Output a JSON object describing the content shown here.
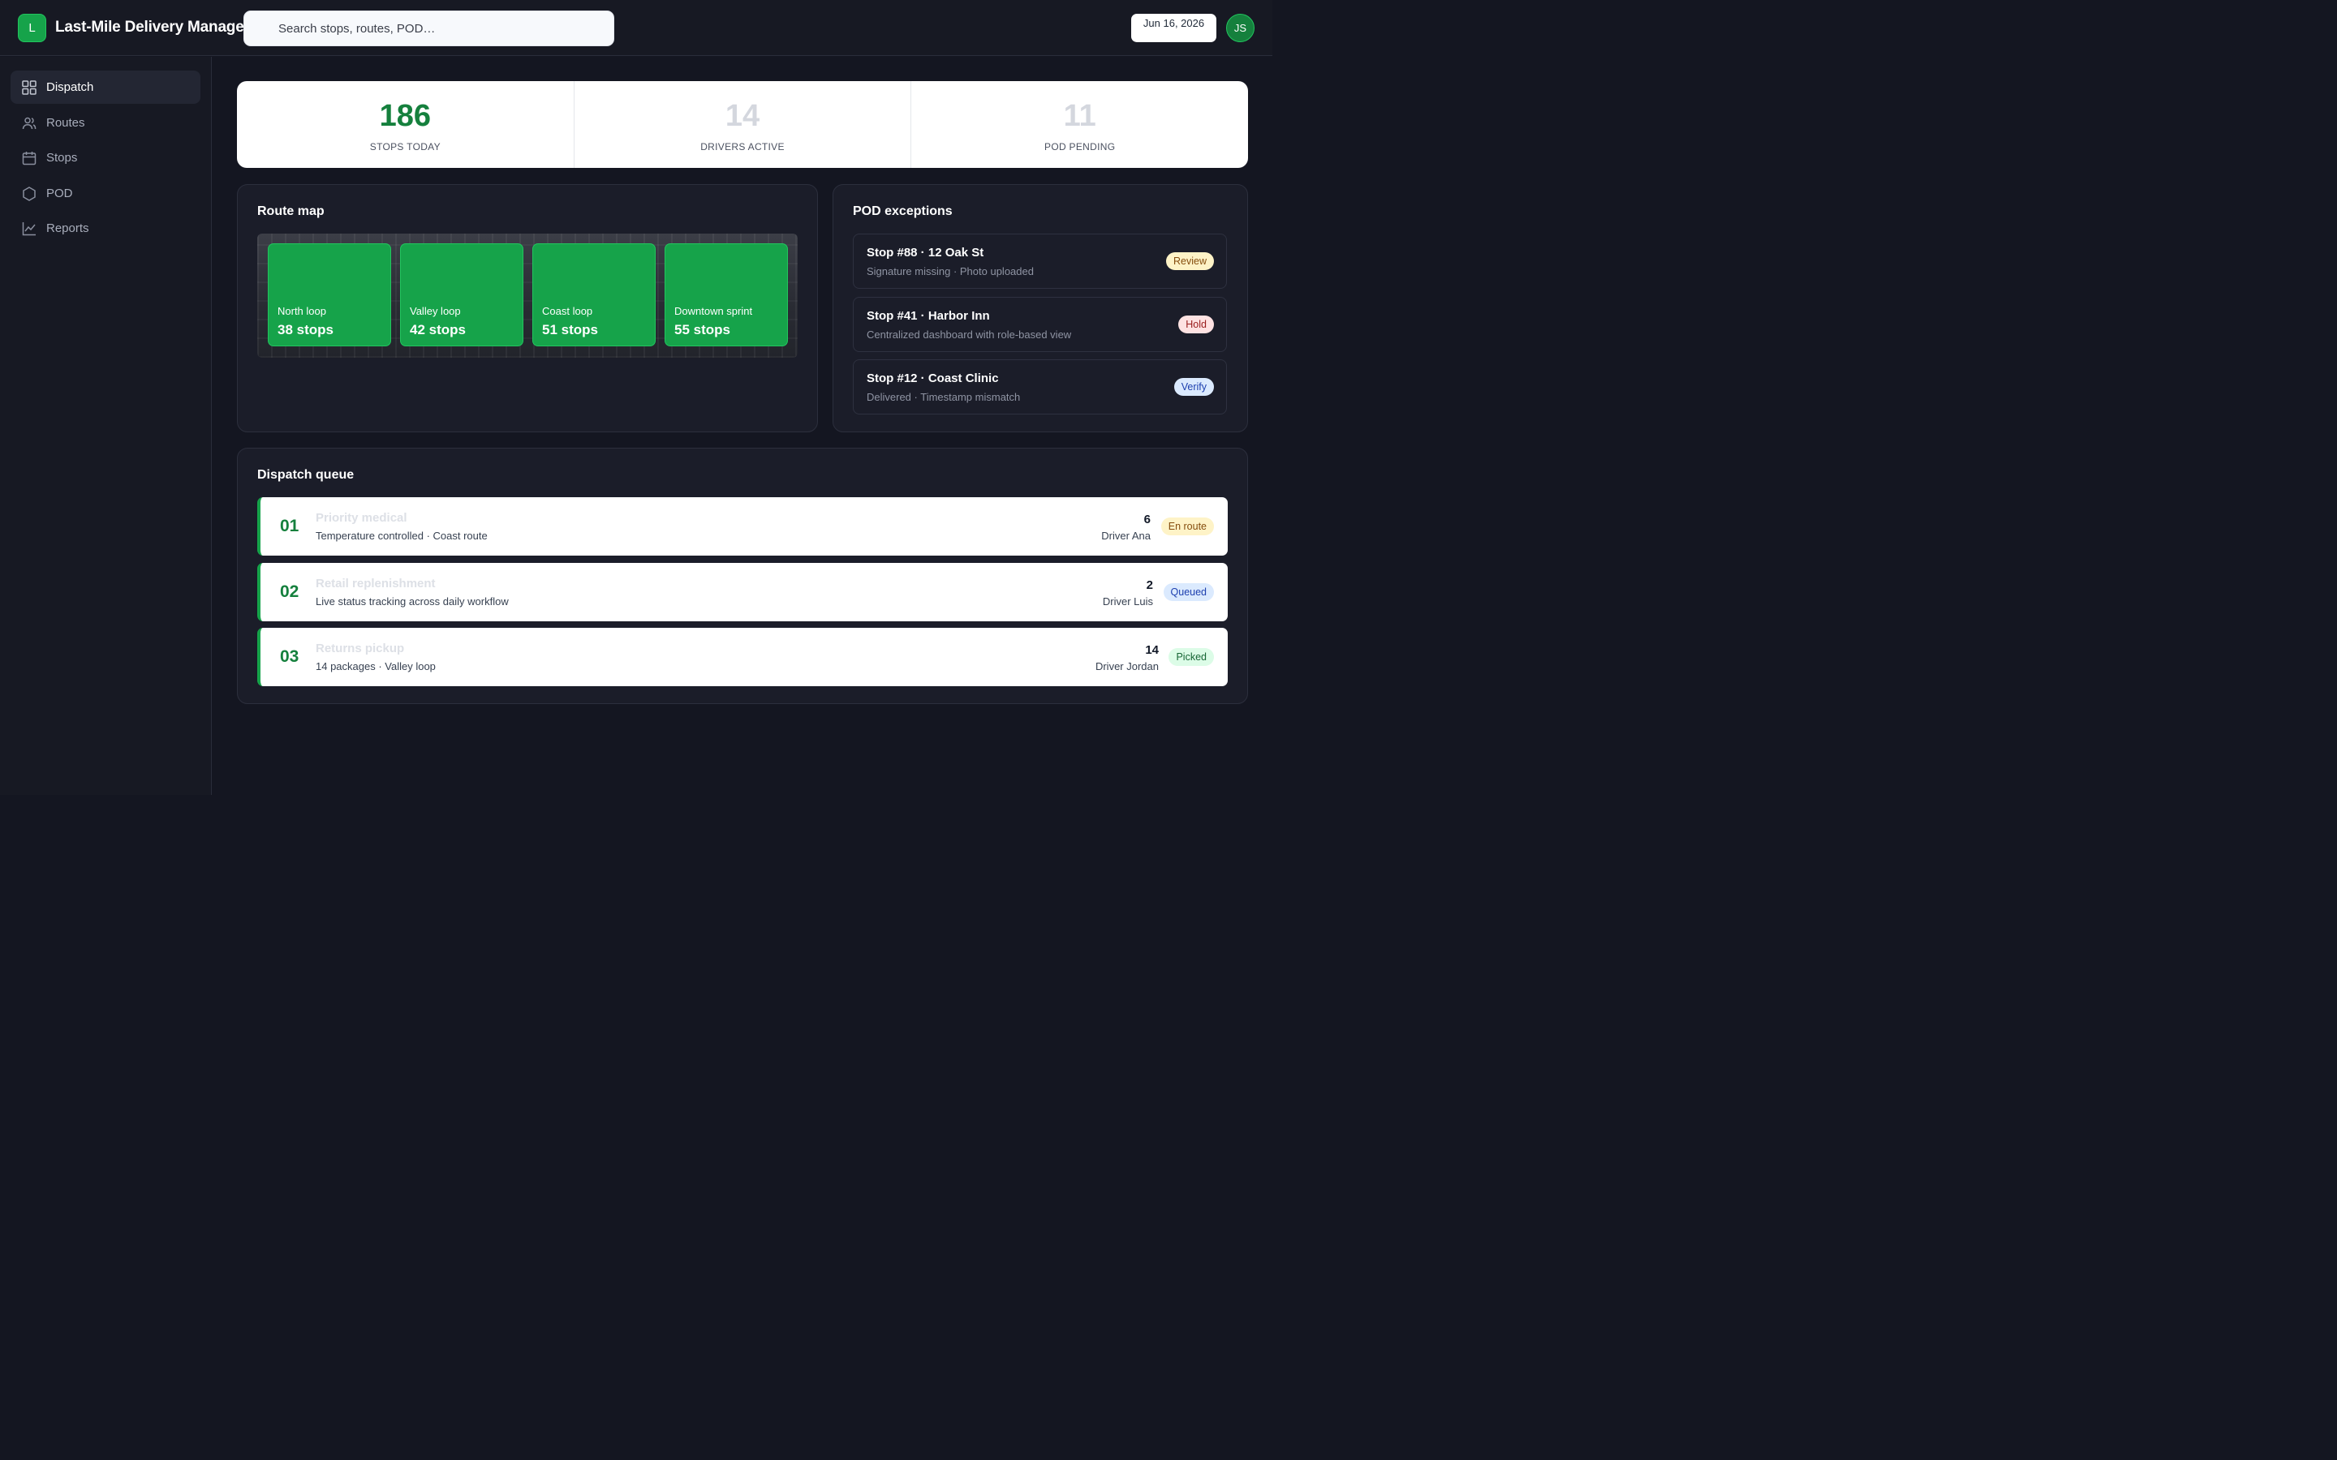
{
  "header": {
    "logo_letter": "L",
    "app_title": "Last-Mile Delivery Manager",
    "search_placeholder": "Search stops, routes, POD…",
    "date": "Jun 16, 2026",
    "user_initials": "JS"
  },
  "sidebar": {
    "items": [
      {
        "label": "Dispatch",
        "icon": "grid-icon",
        "active": true
      },
      {
        "label": "Routes",
        "icon": "users-icon",
        "active": false
      },
      {
        "label": "Stops",
        "icon": "calendar-icon",
        "active": false
      },
      {
        "label": "POD",
        "icon": "hexagon-icon",
        "active": false
      },
      {
        "label": "Reports",
        "icon": "chart-line-icon",
        "active": false
      }
    ]
  },
  "stats": [
    {
      "value": "186",
      "label": "STOPS TODAY"
    },
    {
      "value": "14",
      "label": "DRIVERS ACTIVE"
    },
    {
      "value": "11",
      "label": "POD PENDING"
    }
  ],
  "route_map": {
    "title": "Route map",
    "routes": [
      {
        "name": "North loop",
        "stops": "38 stops"
      },
      {
        "name": "Valley loop",
        "stops": "42 stops"
      },
      {
        "name": "Coast loop",
        "stops": "51 stops"
      },
      {
        "name": "Downtown sprint",
        "stops": "55 stops"
      }
    ]
  },
  "pod_exceptions": {
    "title": "POD exceptions",
    "items": [
      {
        "title": "Stop #88 · 12 Oak St",
        "sub": "Signature missing · Photo uploaded",
        "badge": "Review",
        "badge_color": "#fef3c7"
      },
      {
        "title": "Stop #41 · Harbor Inn",
        "sub": "Centralized dashboard with role-based view",
        "badge": "Hold",
        "badge_color": "#fee2e2"
      },
      {
        "title": "Stop #12 · Coast Clinic",
        "sub": "Delivered · Timestamp mismatch",
        "badge": "Verify",
        "badge_color": "#dbeafe"
      }
    ]
  },
  "dispatch_queue": {
    "title": "Dispatch queue",
    "items": [
      {
        "num": "01",
        "title": "Priority medical",
        "sub": "Temperature controlled · Coast route",
        "count": "6",
        "driver": "Driver Ana",
        "badge": "En route"
      },
      {
        "num": "02",
        "title": "Retail replenishment",
        "sub": "Live status tracking across daily workflow",
        "count": "2",
        "driver": "Driver Luis",
        "badge": "Queued"
      },
      {
        "num": "03",
        "title": "Returns pickup",
        "sub": "14 packages · Valley loop",
        "count": "14",
        "driver": "Driver Jordan",
        "badge": "Picked"
      }
    ]
  },
  "colors": {
    "accent": "#16a34a",
    "background": "#141621",
    "panel": "#1b1d29"
  }
}
